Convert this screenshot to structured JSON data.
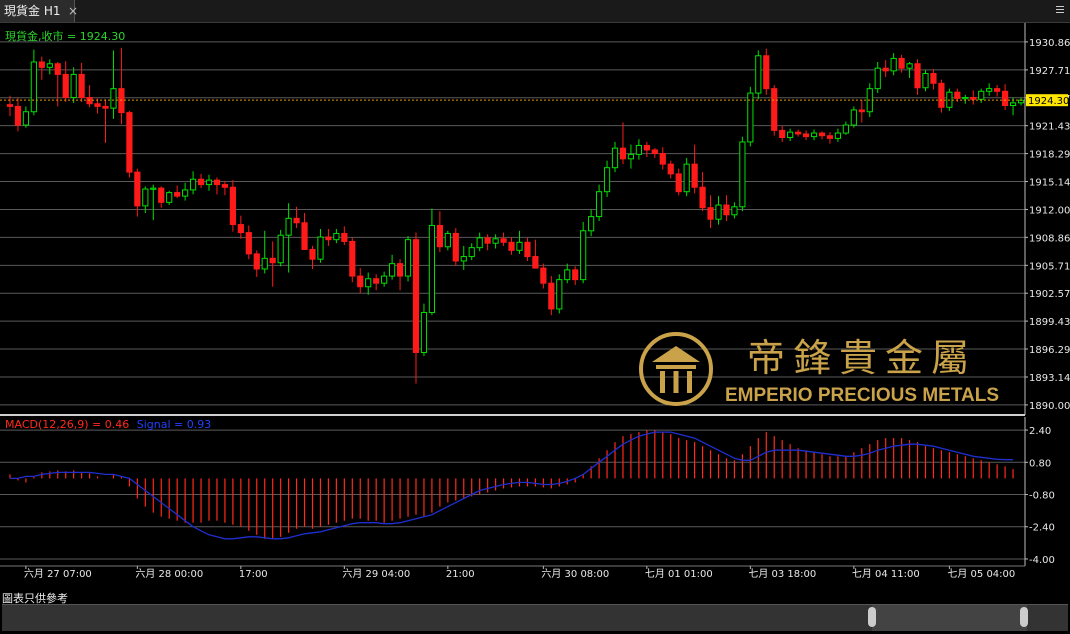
{
  "window": {
    "tab_title": "現貨金 H1",
    "close_glyph": "×"
  },
  "chart_data": [
    {
      "type": "candlestick",
      "title": "現貨金,收市 = 1924.30",
      "ylim": [
        1889.2,
        1932.2
      ],
      "y_ticks": [
        "1930.86",
        "1927.71",
        "1924.57",
        "1921.43",
        "1918.29",
        "1915.14",
        "1912.00",
        "1908.86",
        "1905.71",
        "1902.57",
        "1899.43",
        "1896.29",
        "1893.14",
        "1890.00"
      ],
      "last_price": {
        "label": "1924.30",
        "value": 1924.3
      },
      "x_labels": [
        "六月 27 07:00",
        "六月 28 00:00",
        "17:00",
        "六月 29 04:00",
        "21:00",
        "六月 30 08:00",
        "七月 01 01:00",
        "七月 03 18:00",
        "七月 04 11:00",
        "七月 05 04:00"
      ],
      "x_label_index": [
        2,
        16,
        29,
        42,
        55,
        67,
        80,
        93,
        106,
        118
      ],
      "ohlc": [
        [
          1923.8,
          1924.8,
          1922.5,
          1923.6
        ],
        [
          1923.6,
          1924.6,
          1920.8,
          1921.5
        ],
        [
          1921.5,
          1923.6,
          1921.2,
          1923.0
        ],
        [
          1923.0,
          1930.0,
          1922.6,
          1928.6
        ],
        [
          1928.6,
          1929.2,
          1926.6,
          1928.0
        ],
        [
          1928.0,
          1928.9,
          1927.2,
          1928.4
        ],
        [
          1928.4,
          1928.6,
          1923.6,
          1927.2
        ],
        [
          1927.2,
          1928.7,
          1924.1,
          1924.6
        ],
        [
          1924.6,
          1928.0,
          1924.0,
          1927.2
        ],
        [
          1927.2,
          1928.5,
          1924.1,
          1924.6
        ],
        [
          1924.6,
          1926.0,
          1923.5,
          1923.9
        ],
        [
          1923.9,
          1924.5,
          1922.8,
          1923.6
        ],
        [
          1923.6,
          1924.4,
          1919.5,
          1923.4
        ],
        [
          1923.4,
          1929.9,
          1922.2,
          1925.6
        ],
        [
          1925.6,
          1930.2,
          1921.6,
          1922.9
        ],
        [
          1922.9,
          1923.1,
          1915.6,
          1916.2
        ],
        [
          1916.2,
          1916.6,
          1911.2,
          1912.4
        ],
        [
          1912.4,
          1914.6,
          1911.6,
          1914.3
        ],
        [
          1914.3,
          1914.8,
          1910.8,
          1914.4
        ],
        [
          1914.4,
          1914.6,
          1912.2,
          1912.8
        ],
        [
          1912.8,
          1914.1,
          1912.5,
          1913.9
        ],
        [
          1913.9,
          1914.7,
          1913.3,
          1913.5
        ],
        [
          1913.5,
          1915.0,
          1913.0,
          1914.2
        ],
        [
          1914.2,
          1916.3,
          1913.7,
          1915.4
        ],
        [
          1915.4,
          1916.0,
          1914.4,
          1914.8
        ],
        [
          1914.8,
          1915.9,
          1914.1,
          1915.3
        ],
        [
          1915.3,
          1915.6,
          1913.7,
          1914.8
        ],
        [
          1914.8,
          1915.2,
          1913.6,
          1914.5
        ],
        [
          1914.5,
          1915.3,
          1909.5,
          1910.3
        ],
        [
          1910.3,
          1911.3,
          1908.7,
          1909.4
        ],
        [
          1909.4,
          1910.2,
          1906.4,
          1907.0
        ],
        [
          1907.0,
          1907.4,
          1904.4,
          1905.3
        ],
        [
          1905.3,
          1909.6,
          1904.8,
          1906.5
        ],
        [
          1906.5,
          1908.4,
          1903.3,
          1906.0
        ],
        [
          1906.0,
          1909.7,
          1905.6,
          1909.1
        ],
        [
          1909.1,
          1912.7,
          1904.9,
          1911.0
        ],
        [
          1911.0,
          1912.3,
          1909.9,
          1910.5
        ],
        [
          1910.5,
          1911.6,
          1909.2,
          1907.5
        ],
        [
          1907.5,
          1907.9,
          1905.3,
          1906.4
        ],
        [
          1906.4,
          1909.8,
          1906.0,
          1908.9
        ],
        [
          1908.9,
          1909.8,
          1907.9,
          1908.6
        ],
        [
          1908.6,
          1909.8,
          1908.2,
          1909.3
        ],
        [
          1909.3,
          1910.1,
          1908.0,
          1908.4
        ],
        [
          1908.4,
          1908.8,
          1903.8,
          1904.5
        ],
        [
          1904.5,
          1905.4,
          1902.6,
          1903.3
        ],
        [
          1903.3,
          1904.9,
          1902.4,
          1904.2
        ],
        [
          1904.2,
          1904.7,
          1902.9,
          1903.7
        ],
        [
          1903.7,
          1905.0,
          1903.3,
          1904.5
        ],
        [
          1904.5,
          1906.9,
          1904.1,
          1905.9
        ],
        [
          1905.9,
          1906.4,
          1902.9,
          1904.5
        ],
        [
          1904.5,
          1909.0,
          1903.9,
          1908.6
        ],
        [
          1908.6,
          1909.4,
          1892.4,
          1895.9
        ],
        [
          1895.9,
          1901.4,
          1895.5,
          1900.4
        ],
        [
          1900.4,
          1912.1,
          1900.1,
          1910.2
        ],
        [
          1910.2,
          1911.8,
          1907.2,
          1907.8
        ],
        [
          1907.8,
          1909.6,
          1907.4,
          1909.3
        ],
        [
          1909.3,
          1909.9,
          1905.7,
          1906.2
        ],
        [
          1906.2,
          1907.9,
          1905.2,
          1906.7
        ],
        [
          1906.7,
          1908.2,
          1906.3,
          1907.7
        ],
        [
          1907.7,
          1909.4,
          1907.3,
          1908.8
        ],
        [
          1908.8,
          1909.2,
          1907.4,
          1908.2
        ],
        [
          1908.2,
          1909.2,
          1907.6,
          1908.7
        ],
        [
          1908.7,
          1909.4,
          1907.9,
          1908.3
        ],
        [
          1908.3,
          1908.9,
          1906.9,
          1907.4
        ],
        [
          1907.4,
          1909.6,
          1907.0,
          1908.3
        ],
        [
          1908.3,
          1908.8,
          1906.2,
          1906.7
        ],
        [
          1906.7,
          1908.6,
          1906.4,
          1905.4
        ],
        [
          1905.4,
          1905.9,
          1903.1,
          1903.7
        ],
        [
          1903.7,
          1904.5,
          1900.1,
          1900.8
        ],
        [
          1900.8,
          1904.7,
          1900.3,
          1904.1
        ],
        [
          1904.1,
          1905.9,
          1903.7,
          1905.2
        ],
        [
          1905.2,
          1905.6,
          1903.5,
          1904.1
        ],
        [
          1904.1,
          1910.6,
          1903.7,
          1909.6
        ],
        [
          1909.6,
          1912.0,
          1909.0,
          1911.2
        ],
        [
          1911.2,
          1914.8,
          1910.7,
          1914.0
        ],
        [
          1914.0,
          1917.5,
          1913.4,
          1916.7
        ],
        [
          1916.7,
          1919.6,
          1916.2,
          1918.9
        ],
        [
          1918.9,
          1921.8,
          1917.1,
          1917.7
        ],
        [
          1917.7,
          1919.3,
          1916.6,
          1918.2
        ],
        [
          1918.2,
          1919.9,
          1917.6,
          1919.2
        ],
        [
          1919.2,
          1919.6,
          1917.9,
          1918.7
        ],
        [
          1918.7,
          1918.9,
          1917.8,
          1918.3
        ],
        [
          1918.3,
          1919.0,
          1916.5,
          1917.1
        ],
        [
          1917.1,
          1917.5,
          1915.5,
          1916.0
        ],
        [
          1916.0,
          1916.6,
          1913.6,
          1914.0
        ],
        [
          1914.0,
          1917.8,
          1913.5,
          1917.1
        ],
        [
          1917.1,
          1919.3,
          1913.8,
          1914.5
        ],
        [
          1914.5,
          1916.2,
          1911.8,
          1912.2
        ],
        [
          1912.2,
          1913.6,
          1909.9,
          1910.9
        ],
        [
          1910.9,
          1913.5,
          1910.3,
          1912.5
        ],
        [
          1912.5,
          1913.6,
          1910.7,
          1911.4
        ],
        [
          1911.4,
          1912.8,
          1911.0,
          1912.3
        ],
        [
          1912.3,
          1920.2,
          1911.8,
          1919.6
        ],
        [
          1919.6,
          1925.8,
          1919.1,
          1925.1
        ],
        [
          1925.1,
          1929.9,
          1924.4,
          1929.3
        ],
        [
          1929.3,
          1930.1,
          1924.9,
          1925.6
        ],
        [
          1925.6,
          1926.0,
          1920.3,
          1920.9
        ],
        [
          1920.9,
          1921.4,
          1919.6,
          1920.1
        ],
        [
          1920.1,
          1921.1,
          1919.7,
          1920.7
        ],
        [
          1920.7,
          1921.0,
          1920.2,
          1920.5
        ],
        [
          1920.5,
          1920.9,
          1919.8,
          1920.2
        ],
        [
          1920.2,
          1921.0,
          1919.8,
          1920.6
        ],
        [
          1920.6,
          1920.8,
          1919.9,
          1920.3
        ],
        [
          1920.3,
          1920.7,
          1919.4,
          1920.0
        ],
        [
          1920.0,
          1921.1,
          1919.6,
          1920.6
        ],
        [
          1920.6,
          1921.9,
          1920.4,
          1921.5
        ],
        [
          1921.5,
          1923.6,
          1921.2,
          1923.2
        ],
        [
          1923.2,
          1924.3,
          1921.8,
          1923.0
        ],
        [
          1923.0,
          1926.2,
          1922.4,
          1925.6
        ],
        [
          1925.6,
          1928.6,
          1925.1,
          1927.9
        ],
        [
          1927.9,
          1928.8,
          1926.9,
          1927.6
        ],
        [
          1927.6,
          1929.6,
          1927.1,
          1929.0
        ],
        [
          1929.0,
          1929.4,
          1927.4,
          1927.9
        ],
        [
          1927.9,
          1928.6,
          1926.8,
          1928.4
        ],
        [
          1928.4,
          1928.9,
          1924.9,
          1925.7
        ],
        [
          1925.7,
          1927.7,
          1925.3,
          1927.3
        ],
        [
          1927.3,
          1927.8,
          1925.5,
          1926.2
        ],
        [
          1926.2,
          1926.6,
          1922.9,
          1923.5
        ],
        [
          1923.5,
          1925.6,
          1923.1,
          1925.2
        ],
        [
          1925.2,
          1925.6,
          1924.1,
          1924.5
        ],
        [
          1924.5,
          1924.9,
          1923.9,
          1924.6
        ],
        [
          1924.6,
          1925.4,
          1923.8,
          1924.4
        ],
        [
          1924.4,
          1925.6,
          1924.0,
          1925.3
        ],
        [
          1925.3,
          1926.2,
          1924.8,
          1925.6
        ],
        [
          1925.6,
          1926.0,
          1924.7,
          1925.3
        ],
        [
          1925.3,
          1926.1,
          1923.2,
          1923.7
        ],
        [
          1923.7,
          1924.6,
          1922.6,
          1924.0
        ],
        [
          1924.0,
          1924.6,
          1923.7,
          1924.3
        ]
      ],
      "up_color": "#00e000",
      "down_color": "#ff1a1a"
    },
    {
      "type": "macd",
      "title": "MACD(12,26,9) = 0.46",
      "signal_label": "Signal = 0.93",
      "ylim": [
        -4.2,
        2.9
      ],
      "y_ticks": [
        "2.40",
        "0.80",
        "-0.80",
        "-2.40",
        "-4.00"
      ],
      "y_tick_values": [
        2.4,
        0.8,
        -0.8,
        -2.4,
        -4.0
      ],
      "macd_color": "#ff2a1a",
      "signal_color": "#1f2fd0",
      "macd": [
        0.2,
        -0.1,
        -0.2,
        0.1,
        0.3,
        0.35,
        0.4,
        0.35,
        0.4,
        0.3,
        0.25,
        0.1,
        0.0,
        0.2,
        0.1,
        -0.4,
        -1.0,
        -1.4,
        -1.7,
        -1.9,
        -2.0,
        -2.1,
        -2.2,
        -2.2,
        -2.2,
        -2.1,
        -2.1,
        -2.2,
        -2.3,
        -2.4,
        -2.6,
        -2.8,
        -3.0,
        -3.0,
        -2.9,
        -2.7,
        -2.5,
        -2.4,
        -2.5,
        -2.4,
        -2.3,
        -2.2,
        -2.1,
        -2.0,
        -2.0,
        -2.1,
        -2.1,
        -2.2,
        -2.1,
        -2.0,
        -1.9,
        -1.8,
        -1.9,
        -1.7,
        -1.4,
        -1.2,
        -1.1,
        -1.0,
        -0.9,
        -0.8,
        -0.7,
        -0.6,
        -0.5,
        -0.45,
        -0.4,
        -0.4,
        -0.4,
        -0.45,
        -0.5,
        -0.4,
        -0.3,
        -0.2,
        0.2,
        0.6,
        1.0,
        1.4,
        1.8,
        2.1,
        2.2,
        2.3,
        2.4,
        2.4,
        2.3,
        2.2,
        2.0,
        1.9,
        1.8,
        1.6,
        1.4,
        1.2,
        1.0,
        0.9,
        1.2,
        1.6,
        2.0,
        2.3,
        2.1,
        1.9,
        1.7,
        1.5,
        1.4,
        1.3,
        1.2,
        1.1,
        1.1,
        1.1,
        1.3,
        1.5,
        1.7,
        1.9,
        2.0,
        2.0,
        2.0,
        1.9,
        1.8,
        1.6,
        1.5,
        1.4,
        1.3,
        1.2,
        1.1,
        1.0,
        0.9,
        0.8,
        0.7,
        0.6,
        0.46
      ],
      "signal": [
        0.0,
        0.0,
        0.1,
        0.1,
        0.2,
        0.25,
        0.3,
        0.3,
        0.3,
        0.3,
        0.3,
        0.25,
        0.2,
        0.2,
        0.1,
        0.0,
        -0.3,
        -0.6,
        -0.9,
        -1.2,
        -1.5,
        -1.8,
        -2.1,
        -2.4,
        -2.6,
        -2.8,
        -2.9,
        -3.0,
        -3.0,
        -2.95,
        -2.9,
        -2.9,
        -2.95,
        -3.0,
        -3.0,
        -2.95,
        -2.85,
        -2.75,
        -2.7,
        -2.65,
        -2.55,
        -2.45,
        -2.35,
        -2.25,
        -2.2,
        -2.2,
        -2.2,
        -2.25,
        -2.25,
        -2.2,
        -2.1,
        -2.0,
        -1.9,
        -1.8,
        -1.6,
        -1.4,
        -1.2,
        -1.0,
        -0.8,
        -0.6,
        -0.5,
        -0.4,
        -0.3,
        -0.25,
        -0.2,
        -0.2,
        -0.25,
        -0.3,
        -0.3,
        -0.25,
        -0.15,
        0.0,
        0.2,
        0.5,
        0.8,
        1.1,
        1.4,
        1.7,
        1.9,
        2.1,
        2.2,
        2.3,
        2.3,
        2.3,
        2.2,
        2.1,
        2.0,
        1.8,
        1.6,
        1.4,
        1.2,
        1.0,
        0.9,
        0.9,
        1.1,
        1.3,
        1.4,
        1.4,
        1.4,
        1.4,
        1.35,
        1.3,
        1.25,
        1.2,
        1.15,
        1.1,
        1.1,
        1.15,
        1.25,
        1.4,
        1.5,
        1.6,
        1.65,
        1.7,
        1.7,
        1.65,
        1.6,
        1.5,
        1.4,
        1.3,
        1.2,
        1.1,
        1.05,
        1.0,
        0.95,
        0.93,
        0.93
      ]
    }
  ],
  "logo": {
    "name_cn": "帝鋒貴金屬",
    "name_en": "EMPERIO PRECIOUS METALS",
    "gold_color": "#c9a24a"
  },
  "footer": {
    "disclaimer": "圖表只供參考"
  }
}
